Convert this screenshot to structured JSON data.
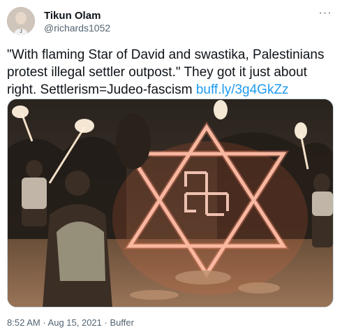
{
  "author": {
    "display_name": "Tikun Olam",
    "handle": "@richards1052"
  },
  "tweet": {
    "text": "\"With flaming Star of David and swastika, Palestinians protest illegal settler outpost.\" They got it just about right. Settlerism=Judeo-fascism ",
    "link": "buff.ly/3g4GkZz",
    "more_label": "···"
  },
  "meta": {
    "time": "8:52 AM",
    "separator1": " · ",
    "date": "Aug 15, 2021",
    "separator2": " · ",
    "source": "Buffer"
  },
  "icons": {
    "more": "more-options-icon"
  },
  "colors": {
    "link": "#1d9bf0",
    "text": "#0f1419",
    "muted": "#536471",
    "border": "#cfd9de"
  }
}
